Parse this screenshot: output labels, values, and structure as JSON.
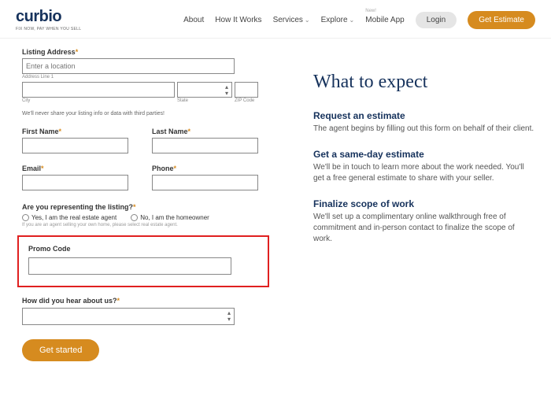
{
  "logo": {
    "text": "curbio",
    "sub": "FIX NOW, PAY WHEN YOU SELL"
  },
  "nav": {
    "about": "About",
    "how": "How It Works",
    "services": "Services",
    "explore": "Explore",
    "mobile_new": "New!",
    "mobile": "Mobile App",
    "login": "Login",
    "estimate": "Get Estimate"
  },
  "form": {
    "listing_label": "Listing Address",
    "listing_placeholder": "Enter a location",
    "addr_line": "Address Line 1",
    "city": "City",
    "state": "State",
    "zip": "ZIP Code",
    "privacy_hint": "We'll never share your listing info or data with third parties!",
    "first_name": "First Name",
    "last_name": "Last Name",
    "email": "Email",
    "phone": "Phone",
    "rep_label": "Are you representing the listing?",
    "rep_yes": "Yes, I am the real estate agent",
    "rep_no": "No, I am the homeowner",
    "rep_hint": "If you are an agent selling your own home, please select real estate agent.",
    "promo_label": "Promo Code",
    "hear_label": "How did you hear about us?",
    "start": "Get started"
  },
  "right": {
    "title": "What to expect",
    "s1_title": "Request an estimate",
    "s1_text": "The agent begins by filling out this form on behalf of their client.",
    "s2_title": "Get a same-day estimate",
    "s2_text": "We'll be in touch to learn more about the work needed. You'll get a free general estimate to share with your seller.",
    "s3_title": "Finalize scope of work",
    "s3_text": "We'll set up a complimentary online walkthrough free of commitment and in-person contact to finalize the scope of work."
  }
}
